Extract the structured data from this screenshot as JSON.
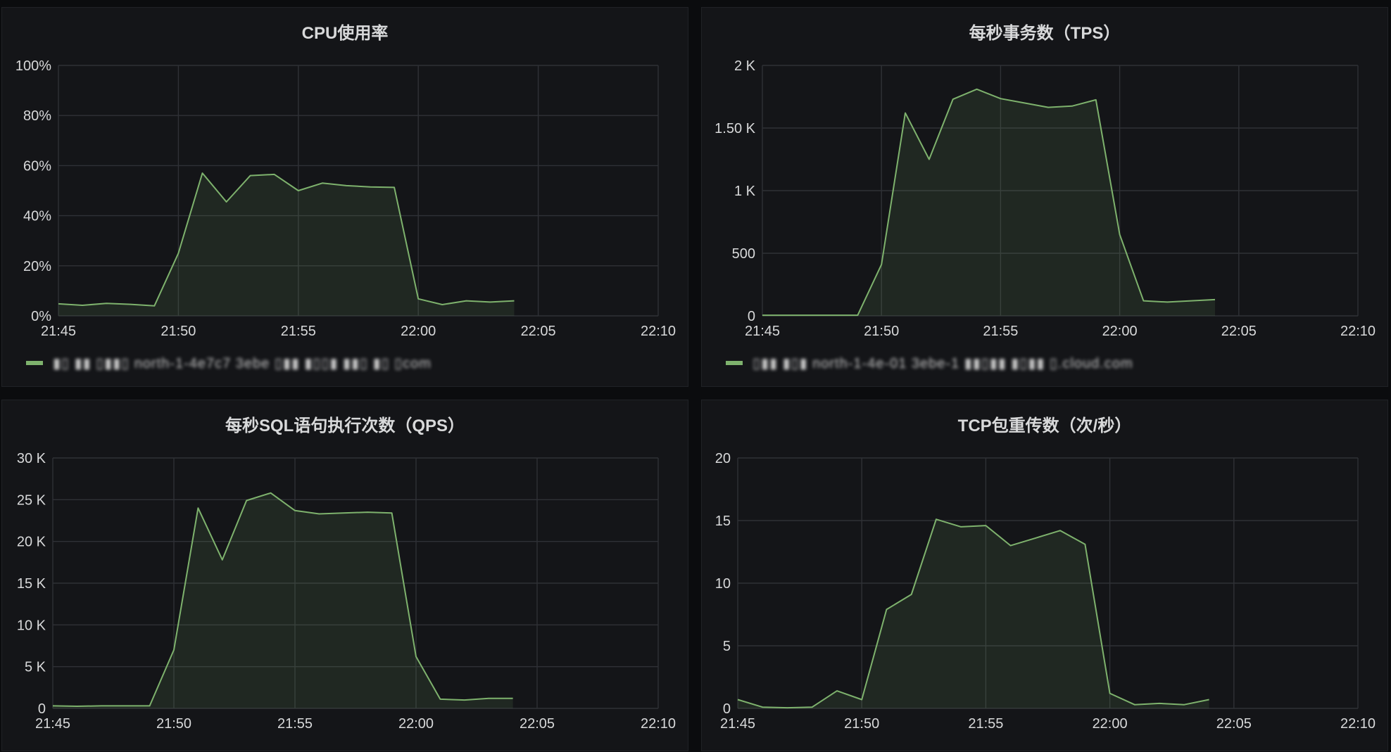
{
  "colors": {
    "series": "#7eb26d",
    "series_fill": "rgba(126,178,109,0.12)",
    "grid": "#2f3136"
  },
  "panels": [
    {
      "title": "CPU使用率",
      "legend": "▮▯ ▮▮ ▯▮▮▯ north-1-4e7c7 3ebe ▯▮▮ ▮▯▯▮ ▮▮▯ ▮▯ ▯com",
      "blurred_legend": true
    },
    {
      "title": "每秒事务数（TPS）",
      "legend": "▯▮▮ ▮▯▮ north-1-4e-01 3ebe-1 ▮▮▯▮▮ ▮▯▮▮ ▯.cloud.com",
      "blurred_legend": true
    },
    {
      "title": "每秒SQL语句执行次数（QPS）",
      "legend": "",
      "blurred_legend": false
    },
    {
      "title": "TCP包重传数（次/秒）",
      "legend": "",
      "blurred_legend": false
    }
  ],
  "chart_data": [
    {
      "type": "area",
      "title": "CPU使用率",
      "x_tick_labels": [
        "21:45",
        "21:50",
        "21:55",
        "22:00",
        "22:05",
        "22:10"
      ],
      "x_range": [
        "21:45",
        "22:10"
      ],
      "y_tick_labels": [
        "0%",
        "20%",
        "40%",
        "60%",
        "80%",
        "100%"
      ],
      "ylim": [
        0,
        100
      ],
      "grid": true,
      "legend_placement": "bottom-left",
      "series": [
        {
          "x": [
            "21:45",
            "21:46",
            "21:47",
            "21:48",
            "21:49",
            "21:50",
            "21:51",
            "21:52",
            "21:53",
            "21:54",
            "21:55",
            "21:56",
            "21:57",
            "21:58",
            "21:59",
            "22:00",
            "22:01",
            "22:02",
            "22:03",
            "22:04"
          ],
          "values": [
            4.8,
            4.2,
            5.0,
            4.6,
            4.0,
            25,
            57,
            45.5,
            56,
            56.5,
            50,
            53,
            52,
            51.5,
            51.3,
            6.8,
            4.5,
            6.0,
            5.5,
            6.0
          ]
        }
      ]
    },
    {
      "type": "area",
      "title": "每秒事务数（TPS）",
      "x_tick_labels": [
        "21:45",
        "21:50",
        "21:55",
        "22:00",
        "22:05",
        "22:10"
      ],
      "x_range": [
        "21:45",
        "22:10"
      ],
      "y_tick_labels": [
        "0",
        "500",
        "1 K",
        "1.50 K",
        "2 K"
      ],
      "y_ticks": [
        0,
        500,
        1000,
        1500,
        2000
      ],
      "ylim": [
        0,
        2000
      ],
      "grid": true,
      "legend_placement": "bottom-left",
      "series": [
        {
          "x": [
            "21:45",
            "21:46",
            "21:47",
            "21:48",
            "21:49",
            "21:50",
            "21:51",
            "21:52",
            "21:53",
            "21:54",
            "21:55",
            "21:56",
            "21:57",
            "21:58",
            "21:59",
            "22:00",
            "22:01",
            "22:02",
            "22:03",
            "22:04"
          ],
          "values": [
            5,
            5,
            5,
            5,
            5,
            410,
            1620,
            1250,
            1730,
            1810,
            1735,
            1700,
            1665,
            1675,
            1725,
            650,
            120,
            110,
            120,
            130
          ]
        }
      ]
    },
    {
      "type": "area",
      "title": "每秒SQL语句执行次数（QPS）",
      "x_tick_labels": [
        "21:45",
        "21:50",
        "21:55",
        "22:00",
        "22:05",
        "22:10"
      ],
      "x_range": [
        "21:45",
        "22:10"
      ],
      "y_tick_labels": [
        "0",
        "5 K",
        "10 K",
        "15 K",
        "20 K",
        "25 K",
        "30 K"
      ],
      "y_ticks": [
        0,
        5000,
        10000,
        15000,
        20000,
        25000,
        30000
      ],
      "ylim": [
        0,
        30000
      ],
      "grid": true,
      "series": [
        {
          "x": [
            "21:45",
            "21:46",
            "21:47",
            "21:48",
            "21:49",
            "21:50",
            "21:51",
            "21:52",
            "21:53",
            "21:54",
            "21:55",
            "21:56",
            "21:57",
            "21:58",
            "21:59",
            "22:00",
            "22:01",
            "22:02",
            "22:03",
            "22:04"
          ],
          "values": [
            300,
            250,
            300,
            300,
            300,
            7000,
            24000,
            17800,
            24900,
            25800,
            23700,
            23300,
            23400,
            23500,
            23400,
            6200,
            1100,
            1000,
            1200,
            1200
          ]
        }
      ]
    },
    {
      "type": "area",
      "title": "TCP包重传数（次/秒）",
      "x_tick_labels": [
        "21:45",
        "21:50",
        "21:55",
        "22:00",
        "22:05",
        "22:10"
      ],
      "x_range": [
        "21:45",
        "22:10"
      ],
      "y_tick_labels": [
        "0",
        "5",
        "10",
        "15",
        "20"
      ],
      "y_ticks": [
        0,
        5,
        10,
        15,
        20
      ],
      "ylim": [
        0,
        20
      ],
      "grid": true,
      "series": [
        {
          "x": [
            "21:45",
            "21:46",
            "21:47",
            "21:48",
            "21:49",
            "21:50",
            "21:51",
            "21:52",
            "21:53",
            "21:54",
            "21:55",
            "21:56",
            "21:57",
            "21:58",
            "21:59",
            "22:00",
            "22:01",
            "22:02",
            "22:03",
            "22:04"
          ],
          "values": [
            0.7,
            0.1,
            0.05,
            0.1,
            1.4,
            0.7,
            7.9,
            9.1,
            15.1,
            14.5,
            14.6,
            13.0,
            13.6,
            14.2,
            13.1,
            1.2,
            0.3,
            0.4,
            0.3,
            0.7
          ]
        }
      ]
    }
  ]
}
